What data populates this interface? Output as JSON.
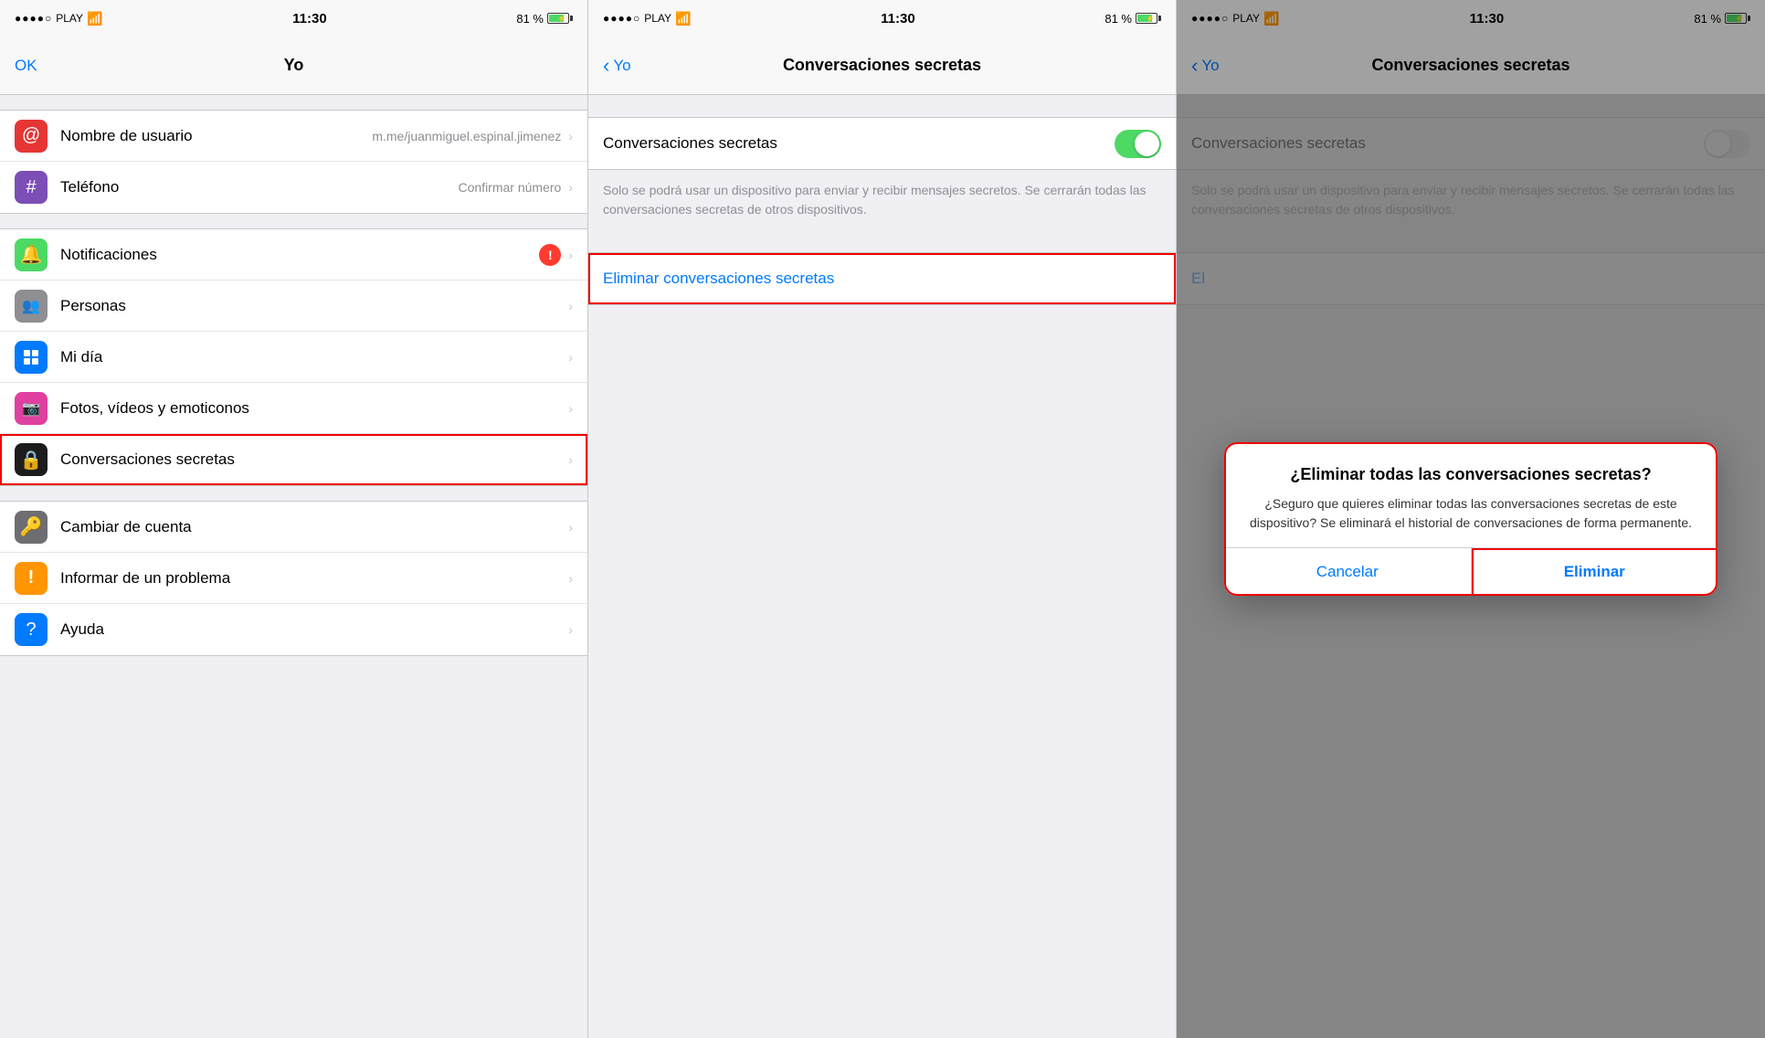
{
  "panel1": {
    "status": {
      "signal": "●●●●○",
      "carrier": "PLAY",
      "wifi": "▾",
      "time": "11:30",
      "battery_pct": "81 %"
    },
    "nav": {
      "ok_label": "OK",
      "title": "Yo"
    },
    "sections": [
      {
        "items": [
          {
            "icon": "@",
            "icon_class": "icon-red",
            "label": "Nombre de usuario",
            "value": "m.me/juanmiguel.espinal.jimenez",
            "has_chevron": true
          },
          {
            "icon": "#",
            "icon_class": "icon-purple",
            "label": "Teléfono",
            "value": "Confirmar número",
            "has_chevron": true
          }
        ]
      },
      {
        "items": [
          {
            "icon": "🔔",
            "icon_class": "icon-green",
            "label": "Notificaciones",
            "has_badge": true,
            "has_chevron": true
          },
          {
            "icon": "👥",
            "icon_class": "icon-gray",
            "label": "Personas",
            "has_chevron": true
          },
          {
            "icon": "⬛",
            "icon_class": "icon-blue",
            "label": "Mi día",
            "has_chevron": true
          },
          {
            "icon": "📷",
            "icon_class": "icon-pink",
            "label": "Fotos, vídeos y emoticonos",
            "has_chevron": true
          },
          {
            "icon": "🔒",
            "icon_class": "icon-black",
            "label": "Conversaciones secretas",
            "has_chevron": true
          }
        ]
      },
      {
        "items": [
          {
            "icon": "🔑",
            "icon_class": "icon-darkgray",
            "label": "Cambiar de cuenta",
            "has_chevron": true
          },
          {
            "icon": "!",
            "icon_class": "icon-orange",
            "label": "Informar de un problema",
            "has_chevron": true
          },
          {
            "icon": "?",
            "icon_class": "icon-blue",
            "label": "Ayuda",
            "has_chevron": true
          }
        ]
      }
    ]
  },
  "panel2": {
    "status": {
      "signal": "●●●●○",
      "carrier": "PLAY",
      "time": "11:30",
      "battery_pct": "81 %"
    },
    "nav": {
      "back_label": "Yo",
      "title": "Conversaciones secretas"
    },
    "toggle_label": "Conversaciones secretas",
    "toggle_state": "on",
    "description": "Solo se podrá usar un dispositivo para enviar y recibir mensajes secretos. Se cerrarán todas las conversaciones secretas de otros dispositivos.",
    "action_label": "Eliminar conversaciones secretas"
  },
  "panel3": {
    "status": {
      "signal": "●●●●○",
      "carrier": "PLAY",
      "time": "11:30",
      "battery_pct": "81 %"
    },
    "nav": {
      "back_label": "Yo",
      "title": "Conversaciones secretas"
    },
    "toggle_label": "Conversaciones secretas",
    "toggle_state": "off",
    "description": "Solo se podrá usar un dispositivo para enviar y recibir mensajes secretos. Se cerrarán todas las conversaciones secretas de otros dispositivos.",
    "action_label": "El",
    "dialog": {
      "title": "¿Eliminar todas las conversaciones secretas?",
      "message": "¿Seguro que quieres eliminar todas las conversaciones secretas de este dispositivo? Se eliminará el historial de conversaciones de forma permanente.",
      "cancel_label": "Cancelar",
      "confirm_label": "Eliminar"
    }
  },
  "icons": {
    "chevron": "›",
    "back_arrow": "‹"
  }
}
